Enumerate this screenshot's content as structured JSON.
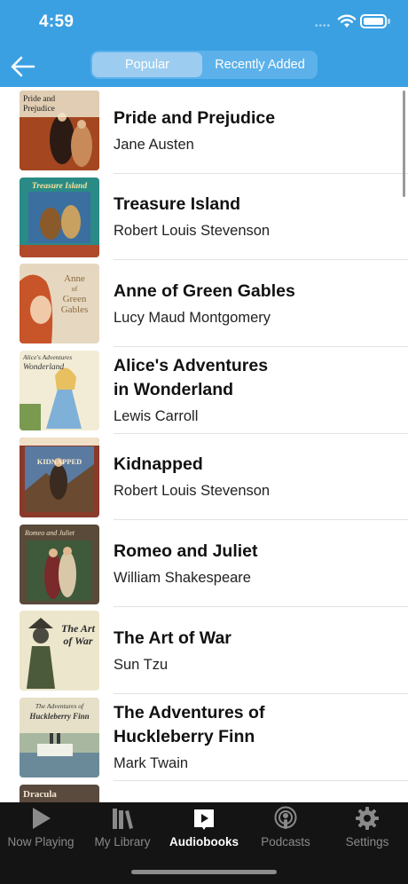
{
  "status_bar": {
    "time": "4:59",
    "dots": "••••"
  },
  "nav": {
    "back_icon": "arrow-left-icon",
    "segments": [
      "Popular",
      "Recently Added"
    ],
    "selected_segment": "Popular"
  },
  "colors": {
    "accent": "#3aa0e2",
    "tabbar": "#141414",
    "active_tab": "#ffffff",
    "inactive_tab": "#8a8a8a"
  },
  "books": [
    {
      "title": "Pride and Prejudice",
      "author": "Jane Austen",
      "cover_text": "Pride and Prejudice"
    },
    {
      "title": "Treasure Island",
      "author": "Robert Louis Stevenson",
      "cover_text": "Treasure Island"
    },
    {
      "title": "Anne of Green Gables",
      "author": "Lucy Maud Montgomery",
      "cover_text": "Anne of Green Gables"
    },
    {
      "title": "Alice's Adventures in Wonderland",
      "author": "Lewis Carroll",
      "cover_text": "Alice's Adventures in Wonderland"
    },
    {
      "title": "Kidnapped",
      "author": "Robert Louis Stevenson",
      "cover_text": "KIDNAPPED"
    },
    {
      "title": "Romeo and Juliet",
      "author": "William Shakespeare",
      "cover_text": "Romeo and Juliet"
    },
    {
      "title": "The Art of War",
      "author": "Sun Tzu",
      "cover_text": "The Art of War"
    },
    {
      "title": "The Adventures of Huckleberry Finn",
      "author": "Mark Twain",
      "cover_text": "The Adventures of Huckleberry Finn"
    },
    {
      "title": "",
      "author": "",
      "cover_text": "Dracula"
    }
  ],
  "tabs": [
    {
      "label": "Now Playing",
      "icon": "play-icon",
      "active": false
    },
    {
      "label": "My Library",
      "icon": "library-icon",
      "active": false
    },
    {
      "label": "Audiobooks",
      "icon": "audiobooks-icon",
      "active": true
    },
    {
      "label": "Podcasts",
      "icon": "podcast-icon",
      "active": false
    },
    {
      "label": "Settings",
      "icon": "gear-icon",
      "active": false
    }
  ]
}
